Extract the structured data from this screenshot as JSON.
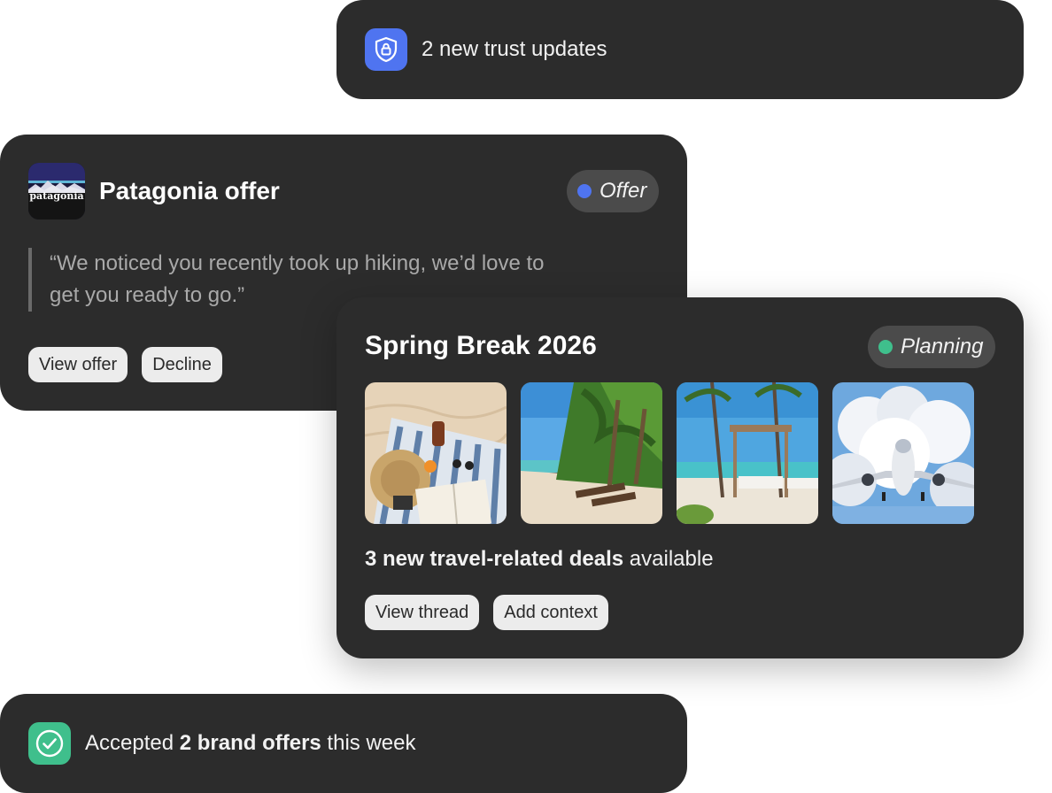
{
  "trust": {
    "text": "2 new trust updates",
    "icon": "shield-lock-icon",
    "accent": "#4f74f0"
  },
  "patagonia": {
    "logo_text": "patagonia",
    "title": "Patagonia offer",
    "badge": {
      "label": "Offer",
      "color": "#4f74f0"
    },
    "quote": "“We noticed you recently took up hiking, we’d love to get you ready to go.”",
    "buttons": {
      "view": "View offer",
      "decline": "Decline"
    }
  },
  "spring": {
    "title": "Spring Break 2026",
    "badge": {
      "label": "Planning",
      "color": "#3fbf8c"
    },
    "thumbnails": [
      "beach-picnic-photo",
      "palm-beach-photo",
      "beach-cabana-photo",
      "airplane-photo"
    ],
    "deals_bold": "3 new travel-related deals",
    "deals_rest": " available",
    "buttons": {
      "thread": "View thread",
      "context": "Add context"
    }
  },
  "accepted": {
    "prefix": "Accepted ",
    "bold": "2 brand offers",
    "suffix": " this week",
    "icon": "check-circle-icon",
    "accent": "#3fbf8c"
  }
}
